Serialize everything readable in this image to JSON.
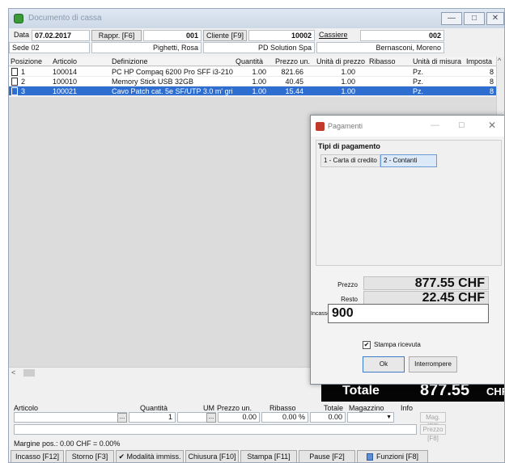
{
  "window": {
    "title": "Documento di cassa",
    "buttons": {
      "minimize": "—",
      "maximize": "□",
      "close": "✕"
    }
  },
  "header": {
    "data_label": "Data",
    "data_value": "07.02.2017",
    "rappr_button": "Rappr. [F6]",
    "rappr_code": "001",
    "cliente_button": "Cliente [F9]",
    "cliente_code": "10002",
    "cassiere_label": "Cassiere",
    "cassiere_code": "002",
    "sede": "Sede 02",
    "rappr_name": "Pighetti, Rosa",
    "cliente_name": "PD Solution Spa",
    "cassiere_name": "Bernasconi, Moreno"
  },
  "grid": {
    "columns": [
      "Posizione",
      "Articolo",
      "Definizione",
      "Quantità",
      "Prezzo un.",
      "Unità di prezzo",
      "Ribasso",
      "Unità di misura",
      "Imposta"
    ],
    "rows": [
      {
        "pos": "1",
        "articolo": "100014",
        "definizione": "PC HP Compaq 6200 Pro SFF i3-2100",
        "quantita": "1.00",
        "prezzo": "821.66",
        "unita_prezzo": "1.00",
        "ribasso": "",
        "unita_misura": "Pz.",
        "imposta": "8"
      },
      {
        "pos": "2",
        "articolo": "100010",
        "definizione": "Memory Stick USB 32GB",
        "quantita": "1.00",
        "prezzo": "40.45",
        "unita_prezzo": "1.00",
        "ribasso": "",
        "unita_misura": "Pz.",
        "imposta": "8"
      },
      {
        "pos": "3",
        "articolo": "100021",
        "definizione": "Cavo Patch cat. 5e SF/UTP 3.0 m' grig",
        "quantita": "1.00",
        "prezzo": "15.44",
        "unita_prezzo": "1.00",
        "ribasso": "",
        "unita_misura": "Pz.",
        "imposta": "8"
      }
    ]
  },
  "totale": {
    "label": "Totale",
    "value": "877.55",
    "currency": "CHF"
  },
  "entry_form": {
    "columns": {
      "articolo": "Articolo",
      "quantita": "Quantità",
      "um": "UM",
      "prezzo": "Prezzo un.",
      "ribasso": "Ribasso",
      "totale": "Totale",
      "magazzino": "Magazzino",
      "info": "Info"
    },
    "values": {
      "quantita": "1",
      "prezzo": "0.00",
      "ribasso": "0.00 %",
      "totale": "0.00"
    },
    "mag_button": "Mag. [F7]",
    "prezzo_button": "Prezzo [F8]",
    "dots": "..."
  },
  "margine": "Margine pos.:  0.00 CHF = 0.00%",
  "toolbar": [
    {
      "label": "Incasso [F12]"
    },
    {
      "label": "Storno [F3]"
    },
    {
      "label": "✔ Modalità immiss."
    },
    {
      "label": "Chiusura [F10]"
    },
    {
      "label": "Stampa [F11]"
    },
    {
      "label": "Pause [F2]"
    },
    {
      "label": "Funzioni [F8]"
    }
  ],
  "dialog": {
    "title": "Pagamenti",
    "group_title": "Tipi di pagamento",
    "types": [
      {
        "label": "1 - Carta di credito"
      },
      {
        "label": "2 - Contanti"
      }
    ],
    "prezzo_label": "Prezzo",
    "prezzo_value": "877.55 CHF",
    "resto_label": "Resto",
    "resto_value": "22.45 CHF",
    "incasso_label": "Incasso",
    "incasso_value": "900",
    "stampa_label": "Stampa ricevuta",
    "stampa_checked": "✔",
    "ok_label": "Ok",
    "interrompere_label": "Interrompere",
    "controls": {
      "minimize": "—",
      "maximize": "□",
      "close": "✕"
    }
  }
}
